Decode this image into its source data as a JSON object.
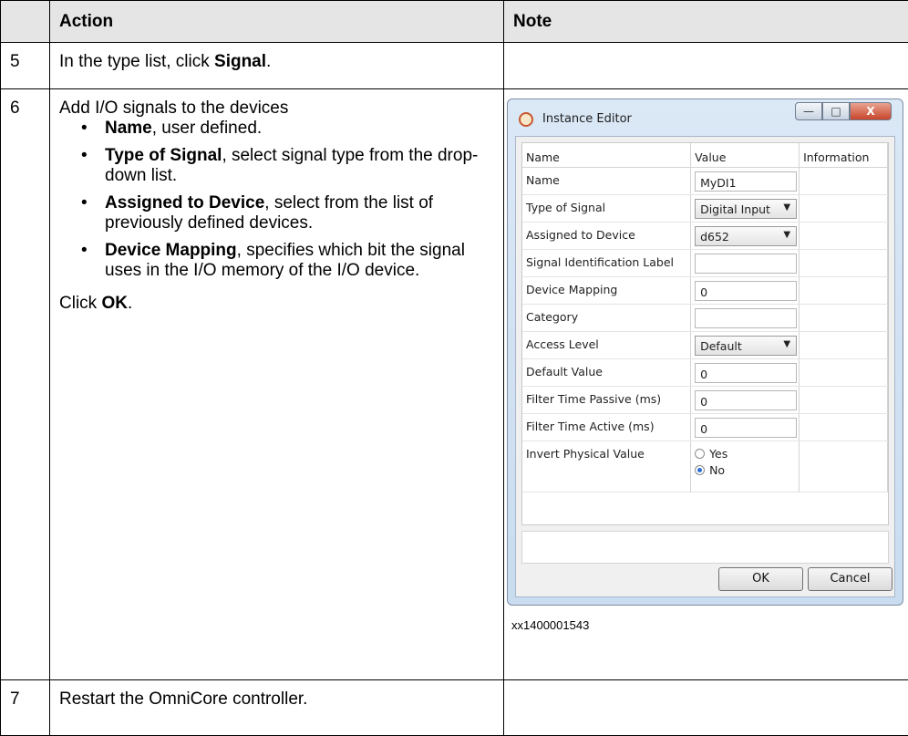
{
  "table": {
    "headers": {
      "action": "Action",
      "note": "Note"
    },
    "rows": {
      "r5": {
        "num": "5",
        "text_pre": "In the type list, click ",
        "text_bold": "Signal",
        "text_post": "."
      },
      "r6": {
        "num": "6",
        "intro": "Add I/O signals to the devices",
        "bullet_glyph": "•",
        "bullets": [
          {
            "bold": "Name",
            "rest": ", user defined."
          },
          {
            "bold": "Type of Signal",
            "rest": ", select signal type from the drop-down list."
          },
          {
            "bold": "Assigned to Device",
            "rest": ", select from the list of previously defined devices."
          },
          {
            "bold": "Device Mapping",
            "rest": ", specifies which bit the signal uses in the I/O memory of the I/O device."
          }
        ],
        "click_pre": "Click ",
        "click_bold": "OK",
        "click_post": "."
      },
      "r7": {
        "num": "7",
        "text": "Restart the OmniCore controller."
      }
    }
  },
  "dialog": {
    "title": "Instance Editor",
    "window_buttons": {
      "minimize": "—",
      "maximize": "□",
      "close": "X"
    },
    "columns": {
      "name": "Name",
      "value": "Value",
      "information": "Information"
    },
    "rows": [
      {
        "name": "Name",
        "value": "MyDI1",
        "kind": "text"
      },
      {
        "name": "Type of Signal",
        "value": "Digital Input",
        "kind": "combo"
      },
      {
        "name": "Assigned to Device",
        "value": "d652",
        "kind": "combo"
      },
      {
        "name": "Signal Identification Label",
        "value": "",
        "kind": "text"
      },
      {
        "name": "Device Mapping",
        "value": "0",
        "kind": "text"
      },
      {
        "name": "Category",
        "value": "",
        "kind": "text"
      },
      {
        "name": "Access Level",
        "value": "Default",
        "kind": "combo"
      },
      {
        "name": "Default Value",
        "value": "0",
        "kind": "text"
      },
      {
        "name": "Filter Time Passive (ms)",
        "value": "0",
        "kind": "text"
      },
      {
        "name": "Filter Time Active (ms)",
        "value": "0",
        "kind": "text"
      }
    ],
    "invert": {
      "name": "Invert Physical Value",
      "options": [
        "Yes",
        "No"
      ],
      "selected": "No"
    },
    "combo_caret": "▼",
    "ok_label": "OK",
    "cancel_label": "Cancel"
  },
  "figure_id": "xx1400001543"
}
